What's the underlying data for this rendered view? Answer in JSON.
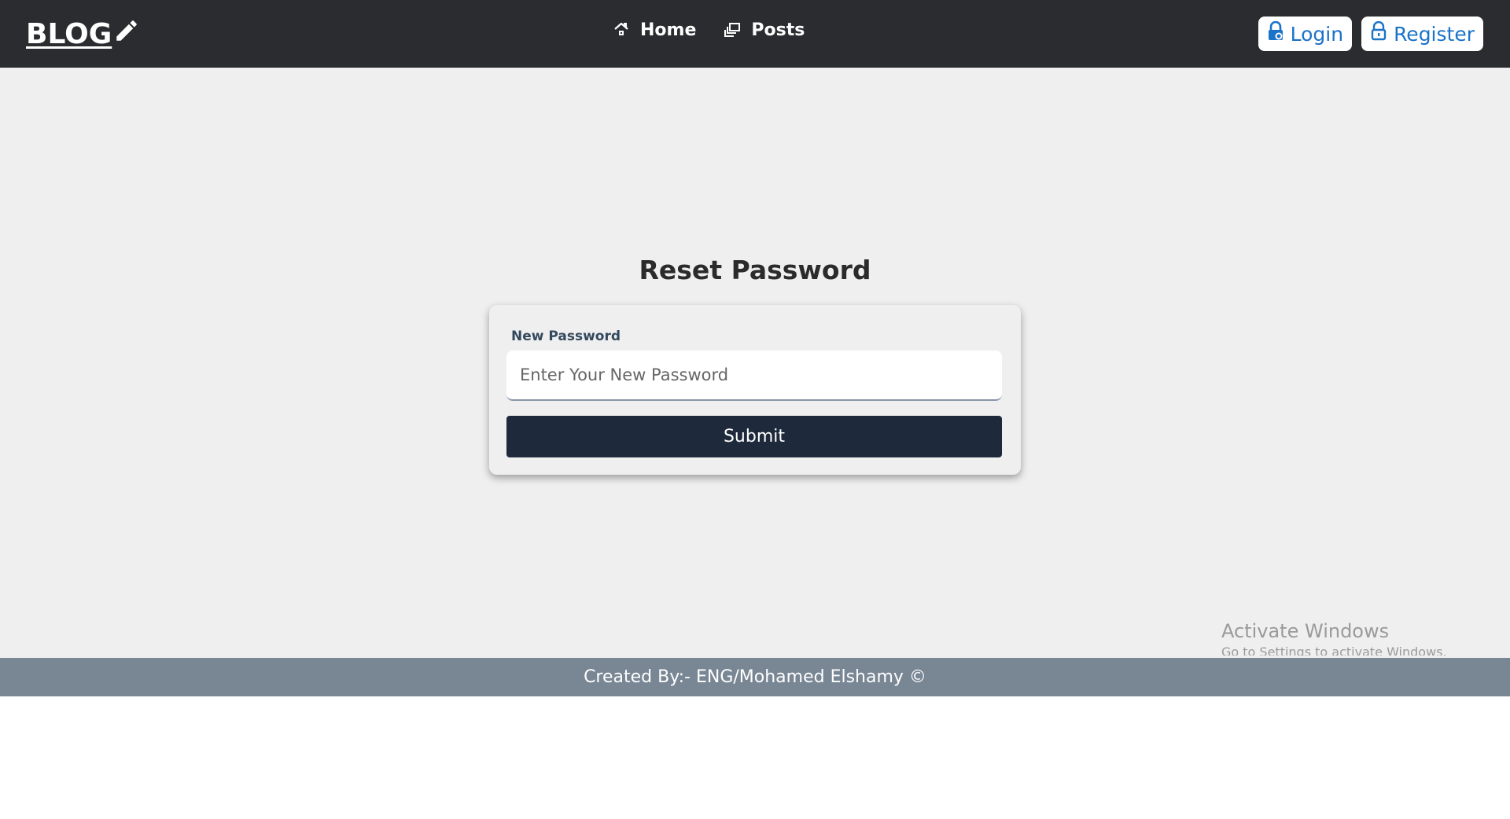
{
  "header": {
    "logo_text": "BLOG",
    "logo_icon": "pencil-icon",
    "nav": [
      {
        "label": "Home",
        "icon": "home-icon"
      },
      {
        "label": "Posts",
        "icon": "posts-icon"
      }
    ],
    "auth": [
      {
        "label": "Login",
        "icon": "lock-icon"
      },
      {
        "label": "Register",
        "icon": "lock-icon"
      }
    ]
  },
  "main": {
    "title": "Reset Password",
    "form": {
      "label": "New Password",
      "placeholder": "Enter Your New Password",
      "value": "",
      "submit_label": "Submit"
    }
  },
  "watermark": {
    "title": "Activate Windows",
    "subtitle": "Go to Settings to activate Windows."
  },
  "footer": {
    "text": "Created By:- ENG/Mohamed Elshamy ©"
  },
  "colors": {
    "navbar_bg": "#2a2c2f",
    "page_bg": "#efefef",
    "submit_bg": "#1e2a3b",
    "footer_bg": "#798795",
    "accent_blue": "#1a73c9"
  }
}
